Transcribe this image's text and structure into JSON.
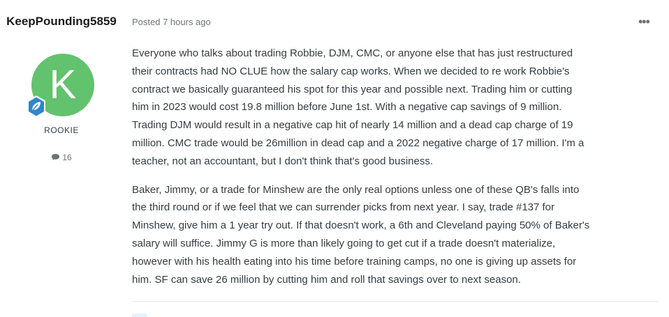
{
  "author": {
    "username": "KeepPounding5859",
    "avatar_letter": "K",
    "avatar_color": "#62c26d",
    "rank_badge_icon": "leaf-badge-icon",
    "rank_title": "ROOKIE",
    "post_count": "16",
    "post_count_icon": "comment-icon"
  },
  "post": {
    "posted_time": "Posted 7 hours ago",
    "more_icon": "more-options-icon",
    "more_label": "•••",
    "paragraphs": [
      "Everyone who talks about trading Robbie, DJM, CMC, or anyone else that has just restructured\ntheir contracts had NO CLUE how the salary cap works.  When we decided to re work Robbie's\ncontract we basically guaranteed his spot for this year and possible next.  Trading him or cutting\nhim in 2023 would cost 19.8 million before June 1st. With a negative cap savings of 9 million.\nTrading DJM would result in a negative cap hit of nearly 14 million and a dead cap charge of 19\nmillion.  CMC trade would be 26million in dead cap and a 2022 negative charge of 17 million.  I'm a\nteacher, not an accountant, but I don't think that's good business.",
      "Baker, Jimmy, or a trade for Minshew are the only real options unless one of these QB's falls into\nthe third round or if we feel that we can surrender picks from next year.  I say, trade #137 for\nMinshew, give him a 1 year try out.  If that doesn't work, a 6th and Cleveland paying 50% of Baker's\nsalary will suffice.  Jimmy G is more than likely going to get cut if a trade doesn't materialize,\nhowever with his health eating into his time before training camps, no one is giving up assets for\nhim.  SF can save 26 million by cutting him and roll that savings over to next season."
    ]
  }
}
